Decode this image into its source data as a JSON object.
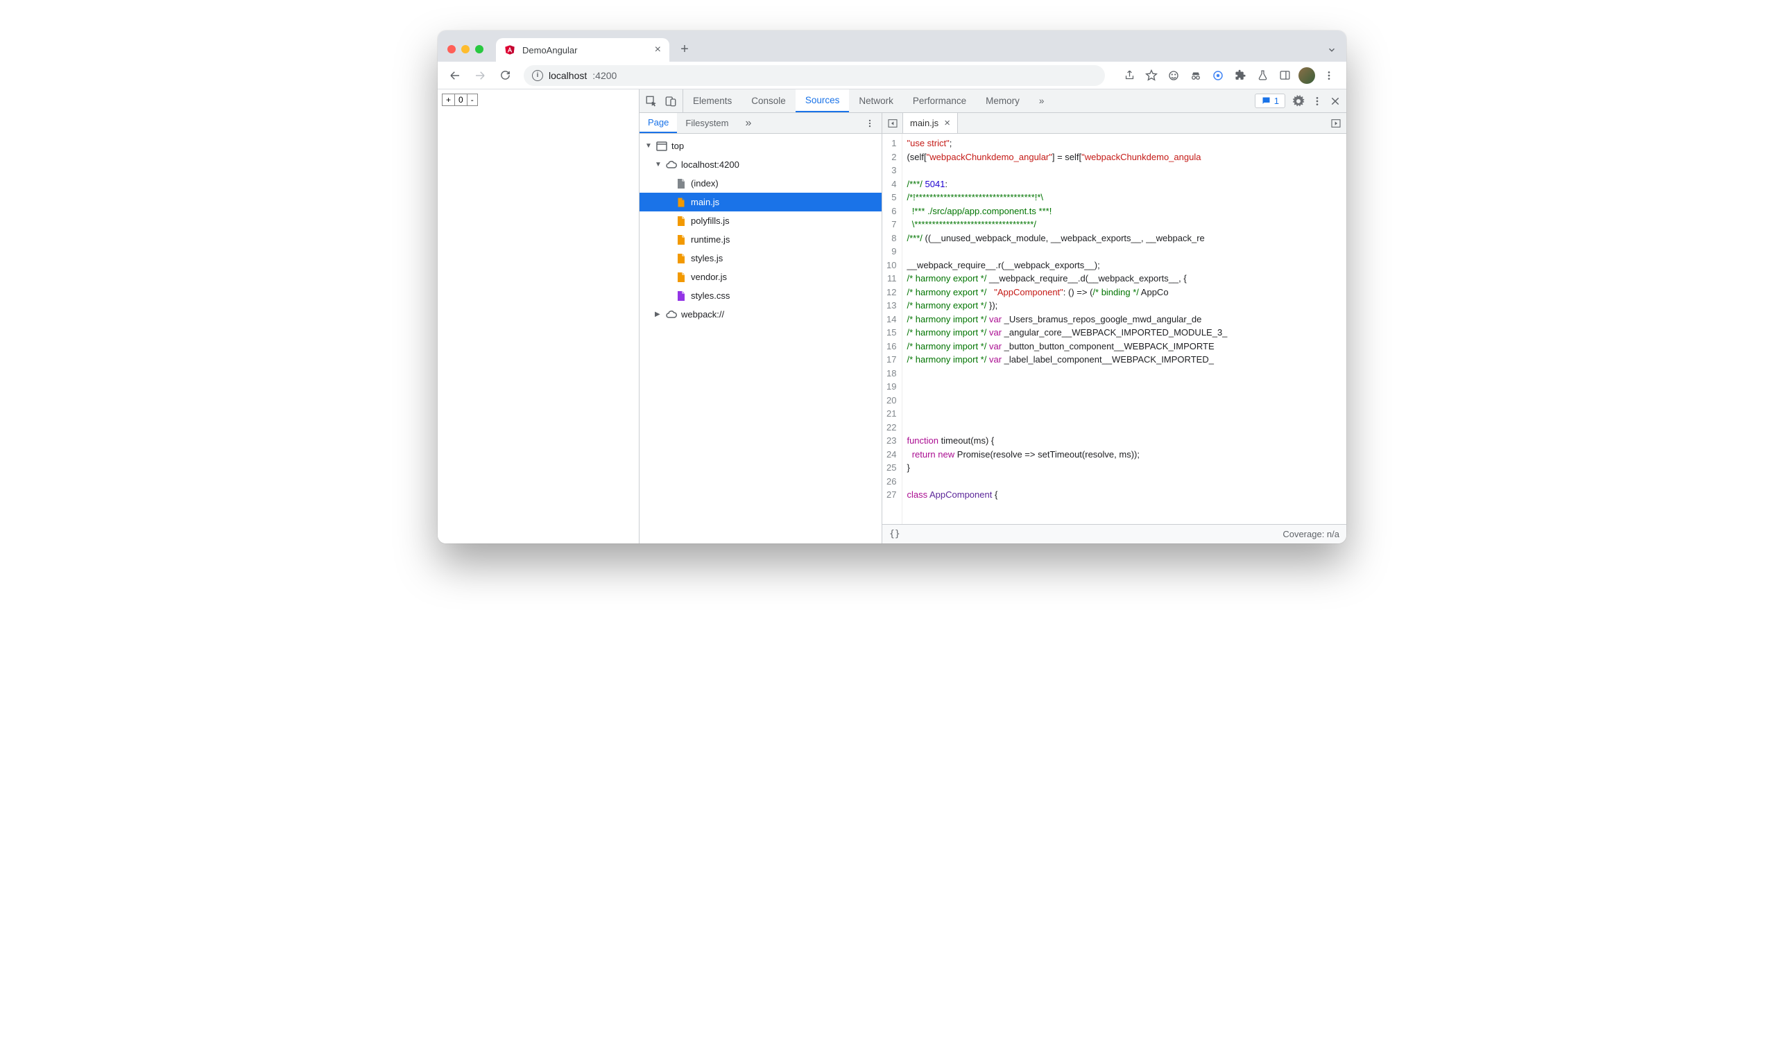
{
  "browser": {
    "tab_title": "DemoAngular",
    "url_host": "localhost",
    "url_port": ":4200"
  },
  "page": {
    "counter_plus": "+",
    "counter_value": "0",
    "counter_minus": "-"
  },
  "devtools": {
    "tabs": [
      "Elements",
      "Console",
      "Sources",
      "Network",
      "Performance",
      "Memory"
    ],
    "active_tab": "Sources",
    "issue_count": "1",
    "nav_subtabs": [
      "Page",
      "Filesystem"
    ],
    "active_subtab": "Page",
    "tree": {
      "top": "top",
      "origin": "localhost:4200",
      "files": [
        "(index)",
        "main.js",
        "polyfills.js",
        "runtime.js",
        "styles.js",
        "vendor.js",
        "styles.css"
      ],
      "selected": "main.js",
      "webpack": "webpack://"
    },
    "editor": {
      "open_file": "main.js",
      "coverage": "Coverage: n/a",
      "format_hint": "{}"
    },
    "code_lines": [
      {
        "n": 1,
        "html": "<span class='tk-str'>\"use strict\"</span>;"
      },
      {
        "n": 2,
        "html": "(self[<span class='tk-str'>\"webpackChunkdemo_angular\"</span>] = self[<span class='tk-str'>\"webpackChunkdemo_angula</span>"
      },
      {
        "n": 3,
        "html": ""
      },
      {
        "n": 4,
        "html": "<span class='tk-cmt'>/***/</span> <span class='tk-num'>5041</span>:"
      },
      {
        "n": 5,
        "html": "<span class='tk-cmt'>/*!**********************************!*\\</span>"
      },
      {
        "n": 6,
        "html": "<span class='tk-cmt'>  !*** ./src/app/app.component.ts ***!</span>"
      },
      {
        "n": 7,
        "html": "<span class='tk-cmt'>  \\**********************************/</span>"
      },
      {
        "n": 8,
        "html": "<span class='tk-cmt'>/***/</span> ((__unused_webpack_module, __webpack_exports__, __webpack_re"
      },
      {
        "n": 9,
        "html": ""
      },
      {
        "n": 10,
        "html": "__webpack_require__.r(__webpack_exports__);"
      },
      {
        "n": 11,
        "html": "<span class='tk-cmt'>/* harmony export */</span> __webpack_require__.d(__webpack_exports__, {"
      },
      {
        "n": 12,
        "html": "<span class='tk-cmt'>/* harmony export */</span>   <span class='tk-str'>\"AppComponent\"</span>: () =&gt; (<span class='tk-cmt'>/* binding */</span> AppCo"
      },
      {
        "n": 13,
        "html": "<span class='tk-cmt'>/* harmony export */</span> });"
      },
      {
        "n": 14,
        "html": "<span class='tk-cmt'>/* harmony import */</span> <span class='tk-kw'>var</span> _Users_bramus_repos_google_mwd_angular_de"
      },
      {
        "n": 15,
        "html": "<span class='tk-cmt'>/* harmony import */</span> <span class='tk-kw'>var</span> _angular_core__WEBPACK_IMPORTED_MODULE_3_"
      },
      {
        "n": 16,
        "html": "<span class='tk-cmt'>/* harmony import */</span> <span class='tk-kw'>var</span> _button_button_component__WEBPACK_IMPORTE"
      },
      {
        "n": 17,
        "html": "<span class='tk-cmt'>/* harmony import */</span> <span class='tk-kw'>var</span> _label_label_component__WEBPACK_IMPORTED_"
      },
      {
        "n": 18,
        "html": ""
      },
      {
        "n": 19,
        "html": ""
      },
      {
        "n": 20,
        "html": ""
      },
      {
        "n": 21,
        "html": ""
      },
      {
        "n": 22,
        "html": ""
      },
      {
        "n": 23,
        "html": "<span class='tk-kw'>function</span> <span class='tk-id'>timeout</span>(ms) {"
      },
      {
        "n": 24,
        "html": "  <span class='tk-kw'>return</span> <span class='tk-kw'>new</span> Promise(resolve =&gt; setTimeout(resolve, ms));"
      },
      {
        "n": 25,
        "html": "}"
      },
      {
        "n": 26,
        "html": ""
      },
      {
        "n": 27,
        "html": "<span class='tk-kw'>class</span> <span class='tk-prp'>AppComponent</span> {"
      }
    ]
  }
}
